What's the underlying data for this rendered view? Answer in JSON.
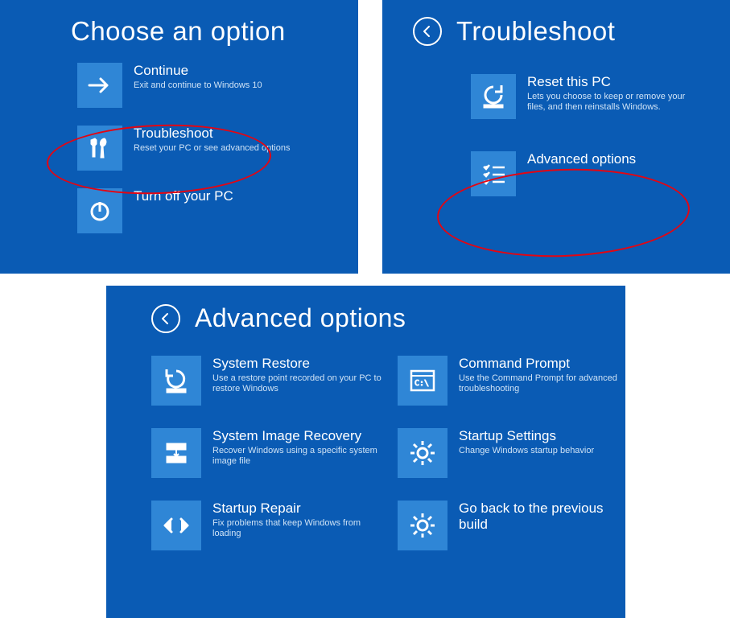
{
  "panel1": {
    "title": "Choose an option",
    "continue": {
      "label": "Continue",
      "desc": "Exit and continue to Windows 10"
    },
    "troubleshoot": {
      "label": "Troubleshoot",
      "desc": "Reset your PC or see advanced options"
    },
    "turn_off": {
      "label": "Turn off your PC"
    }
  },
  "panel2": {
    "title": "Troubleshoot",
    "reset": {
      "label": "Reset this PC",
      "desc": "Lets you choose to keep or remove your files, and then reinstalls Windows."
    },
    "advanced": {
      "label": "Advanced options"
    }
  },
  "panel3": {
    "title": "Advanced options",
    "left": [
      {
        "label": "System Restore",
        "desc": "Use a restore point recorded on your PC to restore Windows"
      },
      {
        "label": "System Image Recovery",
        "desc": "Recover Windows using a specific system image file"
      },
      {
        "label": "Startup Repair",
        "desc": "Fix problems that keep Windows from loading"
      }
    ],
    "right": [
      {
        "label": "Command Prompt",
        "desc": "Use the Command Prompt for advanced troubleshooting"
      },
      {
        "label": "Startup Settings",
        "desc": "Change Windows startup behavior"
      },
      {
        "label": "Go back to the previous build"
      }
    ]
  }
}
